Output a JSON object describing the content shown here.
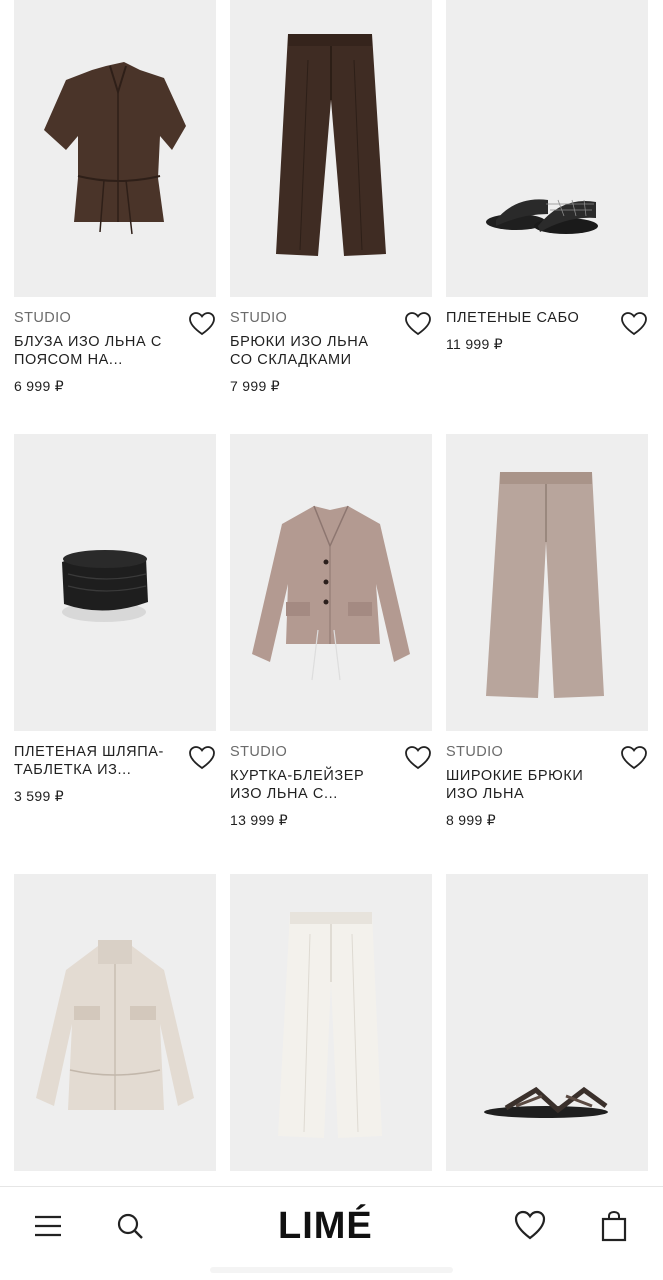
{
  "products": [
    {
      "brand": "STUDIO",
      "name": "БЛУЗА ИЗО ЛЬНА С ПОЯСОМ НА...",
      "price": "6 999 ₽",
      "image": "brown-linen-blouse"
    },
    {
      "brand": "STUDIO",
      "name": "БРЮКИ ИЗО ЛЬНА СО СКЛАДКАМИ",
      "price": "7 999 ₽",
      "image": "brown-linen-trousers"
    },
    {
      "brand": "",
      "name": "ПЛЕТЕНЫЕ САБО",
      "price": "11 999 ₽",
      "image": "black-woven-mules"
    },
    {
      "brand": "",
      "name": "ПЛЕТЕНАЯ ШЛЯПА-ТАБЛЕТКА ИЗ...",
      "price": "3 599 ₽",
      "image": "black-woven-pillbox-hat"
    },
    {
      "brand": "STUDIO",
      "name": "КУРТКА-БЛЕЙЗЕР ИЗО ЛЬНА С...",
      "price": "13 999 ₽",
      "image": "taupe-linen-jacket"
    },
    {
      "brand": "STUDIO",
      "name": "ШИРОКИЕ БРЮКИ ИЗО ЛЬНА",
      "price": "8 999 ₽",
      "image": "taupe-wide-trousers"
    },
    {
      "brand": "",
      "name": "",
      "price": "",
      "image": "beige-linen-jacket"
    },
    {
      "brand": "",
      "name": "",
      "price": "",
      "image": "white-trousers"
    },
    {
      "brand": "",
      "name": "",
      "price": "",
      "image": "brown-strap-sandals"
    }
  ],
  "bottom_nav": {
    "logo": "LIMÉ",
    "icons": [
      "menu-icon",
      "search-icon",
      "heart-icon",
      "bag-icon"
    ]
  },
  "colors": {
    "card_bg": "#eeeeee",
    "text": "#1f1f1f",
    "brand_text": "#6b6b6b"
  }
}
